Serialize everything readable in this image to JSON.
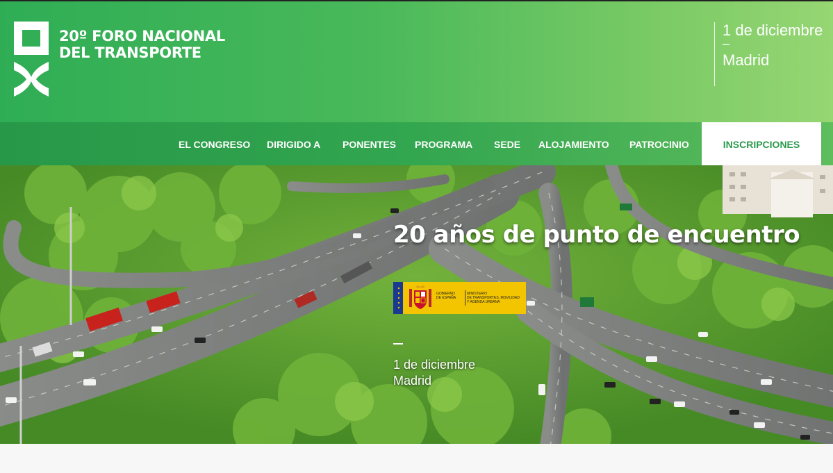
{
  "header": {
    "title_line1": "20º FORO NACIONAL",
    "title_line2": "DEL TRANSPORTE",
    "date": "1 de diciembre",
    "sep": "–",
    "city": "Madrid",
    "logo_icon": "foro-logo-icon"
  },
  "nav": {
    "items": [
      {
        "label": "EL CONGRESO"
      },
      {
        "label": "DIRIGIDO A"
      },
      {
        "label": "PONENTES"
      },
      {
        "label": "PROGRAMA"
      },
      {
        "label": "SEDE"
      },
      {
        "label": "ALOJAMIENTO"
      },
      {
        "label": "PATROCINIO"
      }
    ],
    "cta": "INSCRIPCIONES"
  },
  "banner": {
    "headline": "20 años de punto de encuentro",
    "badge": {
      "gov_line1": "GOBIERNO",
      "gov_line2": "DE ESPAÑA",
      "ministry_line1": "MINISTERIO",
      "ministry_line2": "DE TRANSPORTES, MOVILIDAD",
      "ministry_line3": "Y AGENDA URBANA"
    },
    "date": "1 de diciembre",
    "city": "Madrid"
  },
  "colors": {
    "brand_green": "#2fad55",
    "light_green": "#96d673",
    "cta_text": "#2b9a4e",
    "gov_yellow": "#f3c400"
  }
}
